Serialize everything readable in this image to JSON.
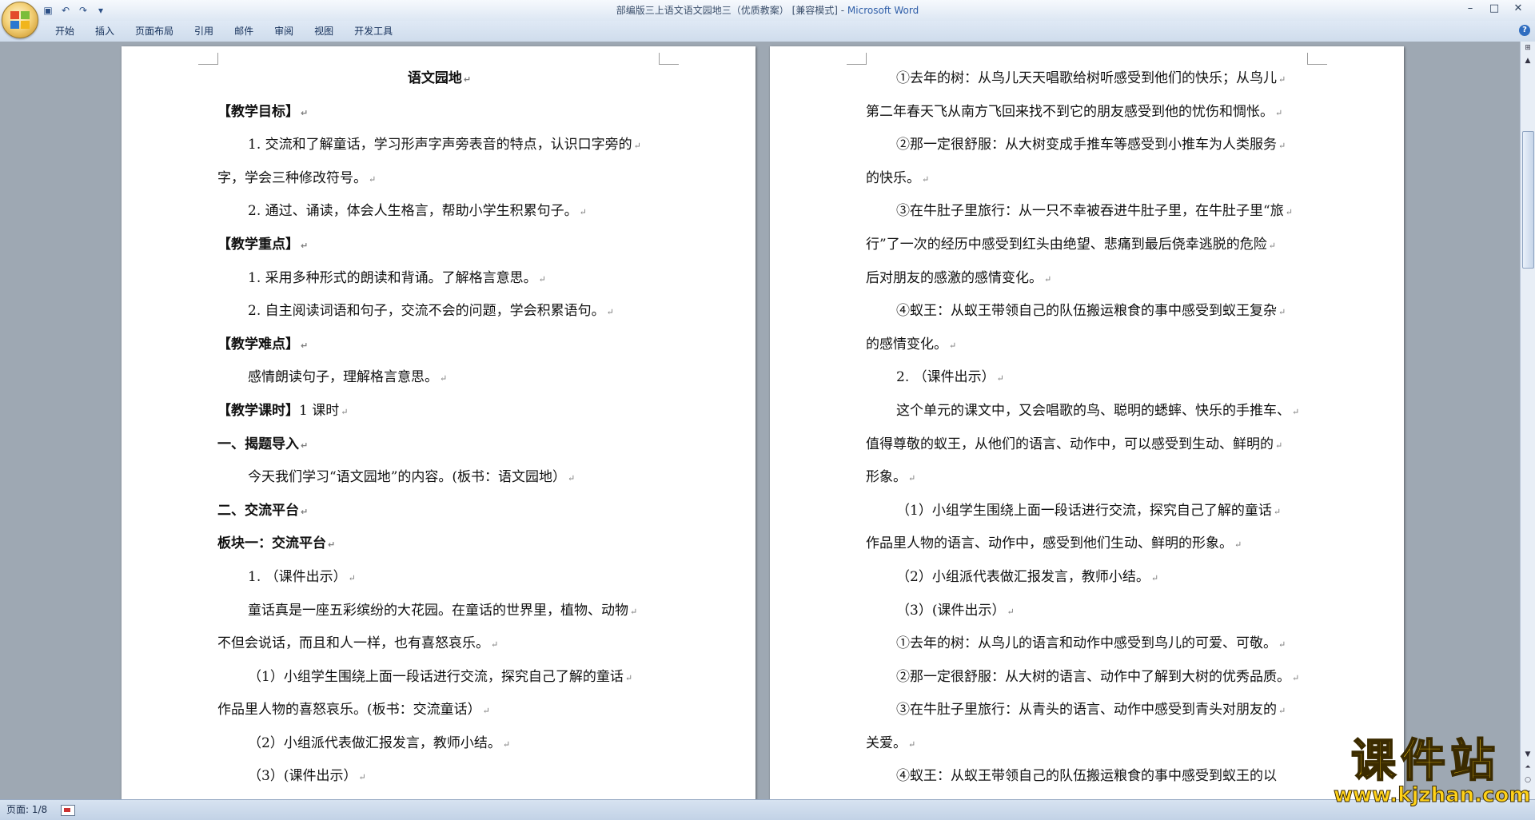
{
  "window": {
    "title_doc": "部编版三上语文语文园地三（优质教案） [兼容模式] - ",
    "title_app": "Microsoft Word"
  },
  "ribbon": {
    "tabs": [
      "开始",
      "插入",
      "页面布局",
      "引用",
      "邮件",
      "审阅",
      "视图",
      "开发工具"
    ]
  },
  "page1": {
    "lines": [
      {
        "text": "语文园地",
        "style": "title"
      },
      {
        "text": "【教学目标】",
        "style": "bold"
      },
      {
        "text": "1. 交流和了解童话，学习形声字声旁表音的特点，认识口字旁的",
        "style": "ind"
      },
      {
        "text": "字，学会三种修改符号。",
        "style": "plain"
      },
      {
        "text": "2. 通过、诵读，体会人生格言，帮助小学生积累句子。",
        "style": "ind"
      },
      {
        "text": "【教学重点】",
        "style": "bold"
      },
      {
        "text": "1. 采用多种形式的朗读和背诵。了解格言意思。",
        "style": "ind"
      },
      {
        "text": "2. 自主阅读词语和句子，交流不会的问题，学会积累语句。",
        "style": "ind"
      },
      {
        "text": "【教学难点】",
        "style": "bold"
      },
      {
        "text": "感情朗读句子，理解格言意思。",
        "style": "ind"
      },
      {
        "text": "【教学课时】1 课时",
        "style": "boldprefix",
        "bold": "【教学课时】",
        "rest": "1 课时"
      },
      {
        "text": "一、揭题导入",
        "style": "bold"
      },
      {
        "text": "今天我们学习“语文园地”的内容。(板书：语文园地）",
        "style": "ind"
      },
      {
        "text": "二、交流平台",
        "style": "bold"
      },
      {
        "text": "板块一：交流平台",
        "style": "bold"
      },
      {
        "text": "1. （课件出示）",
        "style": "ind"
      },
      {
        "text": "童话真是一座五彩缤纷的大花园。在童话的世界里，植物、动物",
        "style": "ind"
      },
      {
        "text": "不但会说话，而且和人一样，也有喜怒哀乐。",
        "style": "plain"
      },
      {
        "text": "（1）小组学生围绕上面一段话进行交流，探究自己了解的童话",
        "style": "ind"
      },
      {
        "text": "作品里人物的喜怒哀乐。(板书：交流童话）",
        "style": "plain"
      },
      {
        "text": "（2）小组派代表做汇报发言，教师小结。",
        "style": "ind"
      },
      {
        "text": "（3）(课件出示）",
        "style": "ind"
      }
    ]
  },
  "page2": {
    "lines": [
      {
        "text": "①去年的树：从鸟儿天天唱歌给树听感受到他们的快乐；从鸟儿",
        "style": "ind"
      },
      {
        "text": "第二年春天飞从南方飞回来找不到它的朋友感受到他的忧伤和惆怅。",
        "style": "plain"
      },
      {
        "text": "②那一定很舒服：从大树变成手推车等感受到小推车为人类服务",
        "style": "ind"
      },
      {
        "text": "的快乐。",
        "style": "plain"
      },
      {
        "text": "③在牛肚子里旅行：从一只不幸被吞进牛肚子里，在牛肚子里“旅",
        "style": "ind"
      },
      {
        "text": "行”了一次的经历中感受到红头由绝望、悲痛到最后侥幸逃脱的危险",
        "style": "plain"
      },
      {
        "text": "后对朋友的感激的感情变化。",
        "style": "plain"
      },
      {
        "text": "④蚁王：从蚁王带领自己的队伍搬运粮食的事中感受到蚁王复杂",
        "style": "ind"
      },
      {
        "text": "的感情变化。",
        "style": "plain"
      },
      {
        "text": "2. （课件出示）",
        "style": "ind"
      },
      {
        "text": "这个单元的课文中，又会唱歌的鸟、聪明的蟋蟀、快乐的手推车、",
        "style": "ind"
      },
      {
        "text": "值得尊敬的蚁王，从他们的语言、动作中，可以感受到生动、鲜明的",
        "style": "plain"
      },
      {
        "text": "形象。",
        "style": "plain"
      },
      {
        "text": "（1）小组学生围绕上面一段话进行交流，探究自己了解的童话",
        "style": "ind"
      },
      {
        "text": "作品里人物的语言、动作中，感受到他们生动、鲜明的形象。",
        "style": "plain"
      },
      {
        "text": "（2）小组派代表做汇报发言，教师小结。",
        "style": "ind"
      },
      {
        "text": "（3）(课件出示）",
        "style": "ind"
      },
      {
        "text": "①去年的树：从鸟儿的语言和动作中感受到鸟儿的可爱、可敬。",
        "style": "ind"
      },
      {
        "text": "②那一定很舒服：从大树的语言、动作中了解到大树的优秀品质。",
        "style": "ind"
      },
      {
        "text": "③在牛肚子里旅行：从青头的语言、动作中感受到青头对朋友的",
        "style": "ind"
      },
      {
        "text": "关爱。",
        "style": "plain"
      },
      {
        "text": "④蚁王：从蚁王带领自己的队伍搬运粮食的事中感受到蚁王的以",
        "style": "ind",
        "nomark": true
      }
    ]
  },
  "status": {
    "page": "页面: 1/8"
  },
  "watermark": {
    "big": "课件站",
    "url": "www.kjzhan.com"
  },
  "colors": {
    "accent": "#2f5ea8",
    "background": "#9ea8b3",
    "watermark": "#ffd21a"
  }
}
